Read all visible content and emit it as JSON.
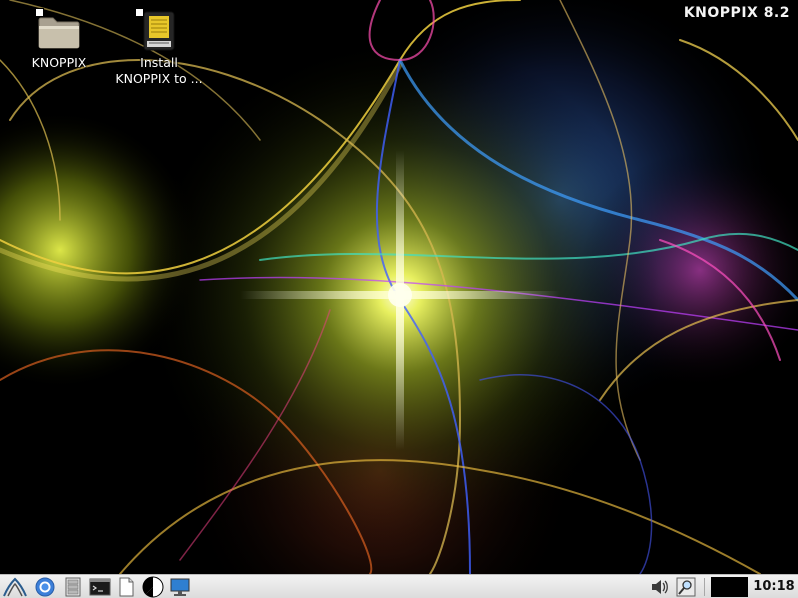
{
  "wallpaper": {
    "brand_text": "KNOPPIX 8.2"
  },
  "desktop_icons": [
    {
      "label": "KNOPPIX",
      "icon": "folder-icon"
    },
    {
      "label": "Install\nKNOPPIX to ...",
      "icon": "install-drive-icon"
    }
  ],
  "taskbar": {
    "launchers": [
      {
        "name": "start-menu-button",
        "icon": "knoppix-menu-icon"
      },
      {
        "name": "browser-launcher",
        "icon": "chromium-icon"
      },
      {
        "name": "file-manager-launcher",
        "icon": "file-manager-icon"
      },
      {
        "name": "terminal-launcher",
        "icon": "terminal-icon"
      },
      {
        "name": "text-editor-launcher",
        "icon": "text-editor-icon"
      },
      {
        "name": "show-desktop-launcher",
        "icon": "pie-icon"
      },
      {
        "name": "display-settings-launcher",
        "icon": "monitor-icon"
      }
    ],
    "tray": {
      "volume_icon": "speaker-icon",
      "search_icon": "magnifier-icon",
      "clock": "10:18"
    }
  }
}
